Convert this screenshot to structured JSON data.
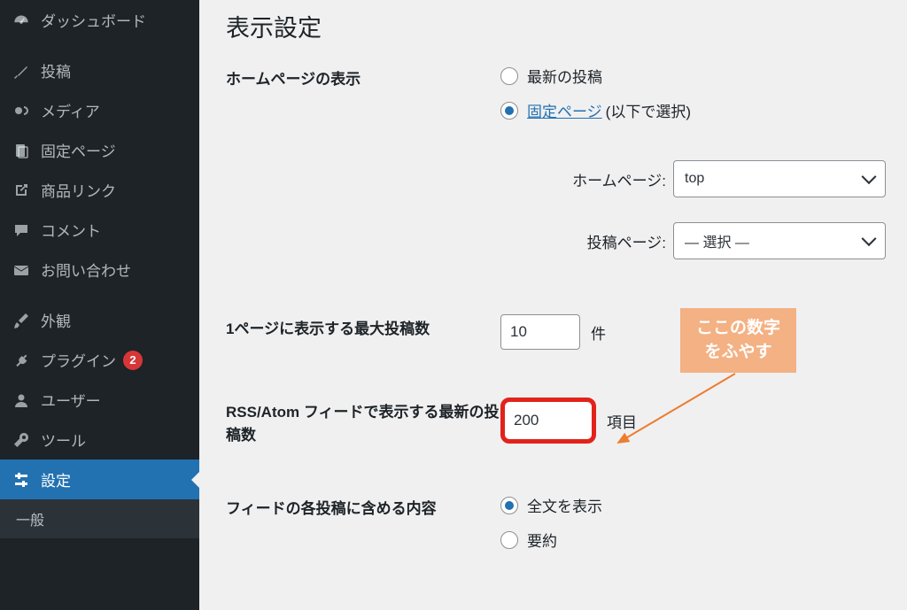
{
  "sidebar": {
    "items": [
      {
        "name": "dashboard",
        "label": "ダッシュボード",
        "icon": "dashboard"
      },
      {
        "gap": true
      },
      {
        "name": "posts",
        "label": "投稿",
        "icon": "pin"
      },
      {
        "name": "media",
        "label": "メディア",
        "icon": "media"
      },
      {
        "name": "pages",
        "label": "固定ページ",
        "icon": "pages"
      },
      {
        "name": "product-links",
        "label": "商品リンク",
        "icon": "link-out"
      },
      {
        "name": "comments",
        "label": "コメント",
        "icon": "comment"
      },
      {
        "name": "contact",
        "label": "お問い合わせ",
        "icon": "mail"
      },
      {
        "gap": true
      },
      {
        "name": "appearance",
        "label": "外観",
        "icon": "brush"
      },
      {
        "name": "plugins",
        "label": "プラグイン",
        "icon": "plug",
        "badge": "2"
      },
      {
        "name": "users",
        "label": "ユーザー",
        "icon": "user"
      },
      {
        "name": "tools",
        "label": "ツール",
        "icon": "wrench"
      },
      {
        "name": "settings",
        "label": "設定",
        "icon": "settings",
        "active": true
      }
    ],
    "sub": {
      "label": "一般"
    }
  },
  "main": {
    "title": "表示設定",
    "homepage": {
      "label": "ホームページの表示",
      "radio_latest": "最新の投稿",
      "radio_static": "固定ページ",
      "radio_static_suffix": "(以下で選択)",
      "homepage_label": "ホームページ:",
      "homepage_value": "top",
      "posts_page_label": "投稿ページ:",
      "posts_page_value": "— 選択 —"
    },
    "posts_per_page": {
      "label": "1ページに表示する最大投稿数",
      "value": "10",
      "suffix": "件"
    },
    "rss_items": {
      "label": "RSS/Atom フィードで表示する最新の投稿数",
      "value": "200",
      "suffix": "項目"
    },
    "feed_content": {
      "label": "フィードの各投稿に含める内容",
      "radio_full": "全文を表示",
      "radio_summary": "要約"
    }
  },
  "annotation": {
    "line1": "ここの数字",
    "line2": "をふやす"
  }
}
